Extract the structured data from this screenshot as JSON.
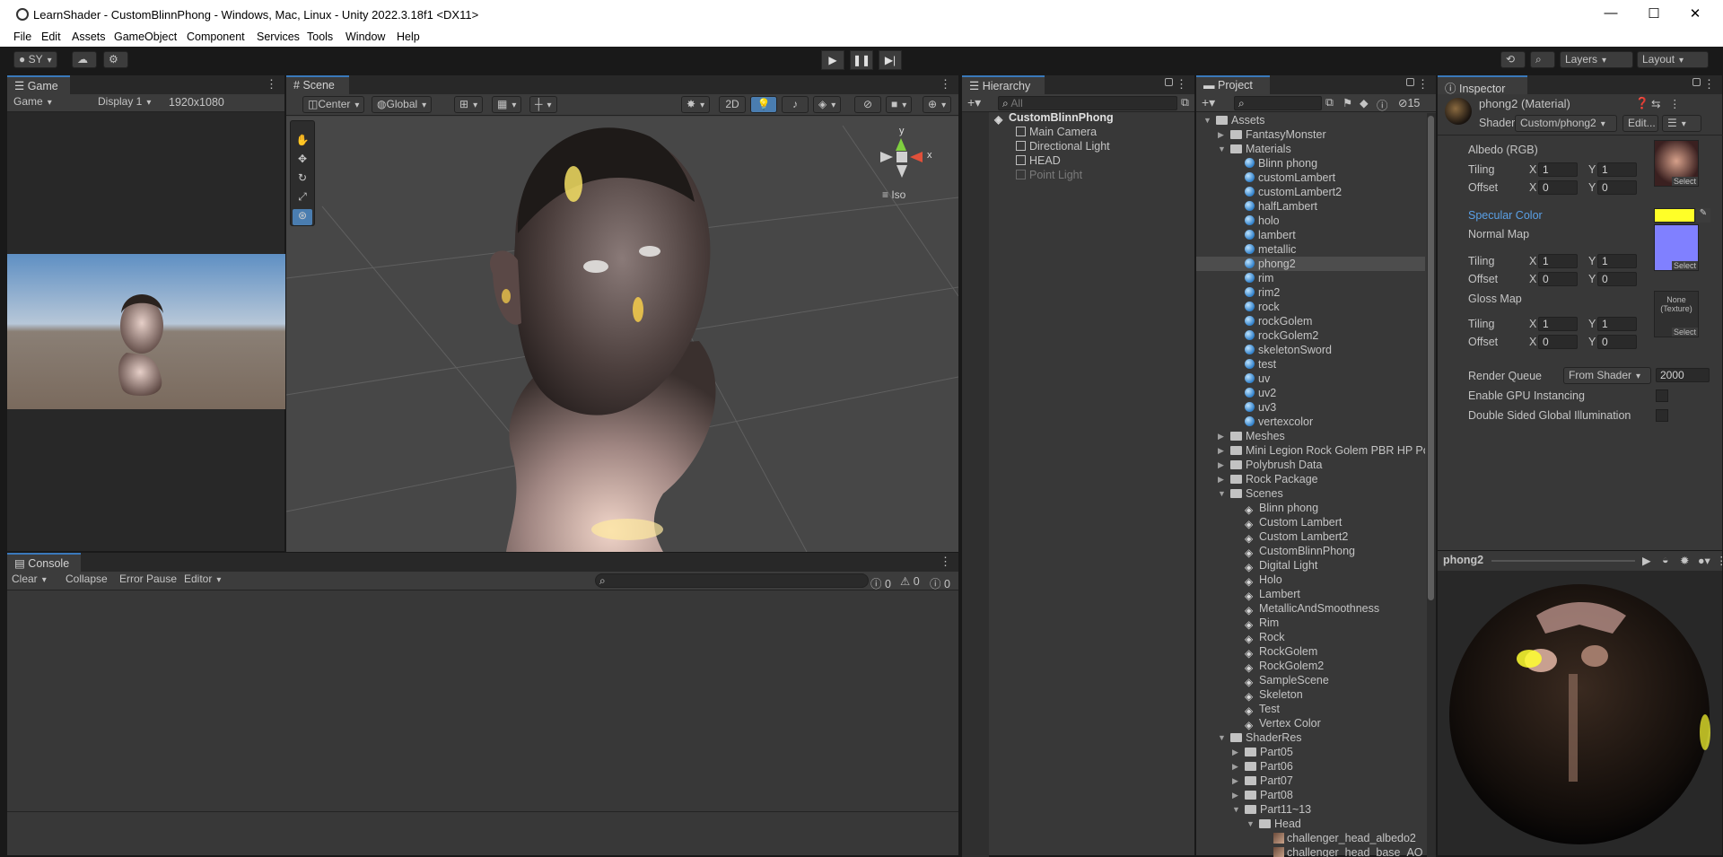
{
  "window": {
    "title": "LearnShader - CustomBlinnPhong - Windows, Mac, Linux - Unity 2022.3.18f1 <DX11>",
    "minimize": "—",
    "maximize": "☐",
    "close": "✕"
  },
  "menu": [
    "File",
    "Edit",
    "Assets",
    "GameObject",
    "Component",
    "Services",
    "Tools",
    "Window",
    "Help"
  ],
  "toolbar": {
    "account": "SY",
    "layers": "Layers",
    "layout": "Layout"
  },
  "game": {
    "tab": "Game",
    "mode": "Game",
    "display": "Display 1",
    "resolution": "1920x1080"
  },
  "scene": {
    "tab": "Scene",
    "pivot": "Center",
    "space": "Global",
    "mode2d": "2D",
    "projection": "Iso",
    "gizmo_y": "y",
    "gizmo_x": "x"
  },
  "hierarchy": {
    "tab": "Hierarchy",
    "search_placeholder": "All",
    "root": "CustomBlinnPhong",
    "items": [
      {
        "label": "Main Camera",
        "active": true
      },
      {
        "label": "Directional Light",
        "active": true
      },
      {
        "label": "HEAD",
        "active": true
      },
      {
        "label": "Point Light",
        "active": false
      }
    ]
  },
  "project": {
    "tab": "Project",
    "hidden_count": "15",
    "tree": [
      {
        "label": "Assets",
        "type": "folder",
        "depth": 0,
        "open": true
      },
      {
        "label": "FantasyMonster",
        "type": "folder",
        "depth": 1,
        "open": false
      },
      {
        "label": "Materials",
        "type": "folder",
        "depth": 1,
        "open": true
      },
      {
        "label": "Blinn phong",
        "type": "mat",
        "depth": 2
      },
      {
        "label": "customLambert",
        "type": "mat",
        "depth": 2
      },
      {
        "label": "customLambert2",
        "type": "mat",
        "depth": 2
      },
      {
        "label": "halfLambert",
        "type": "mat",
        "depth": 2
      },
      {
        "label": "holo",
        "type": "mat",
        "depth": 2
      },
      {
        "label": "lambert",
        "type": "mat",
        "depth": 2
      },
      {
        "label": "metallic",
        "type": "mat",
        "depth": 2
      },
      {
        "label": "phong2",
        "type": "mat",
        "depth": 2,
        "selected": true
      },
      {
        "label": "rim",
        "type": "mat",
        "depth": 2
      },
      {
        "label": "rim2",
        "type": "mat",
        "depth": 2
      },
      {
        "label": "rock",
        "type": "mat",
        "depth": 2
      },
      {
        "label": "rockGolem",
        "type": "mat",
        "depth": 2
      },
      {
        "label": "rockGolem2",
        "type": "mat",
        "depth": 2
      },
      {
        "label": "skeletonSword",
        "type": "mat",
        "depth": 2
      },
      {
        "label": "test",
        "type": "mat",
        "depth": 2
      },
      {
        "label": "uv",
        "type": "mat",
        "depth": 2
      },
      {
        "label": "uv2",
        "type": "mat",
        "depth": 2
      },
      {
        "label": "uv3",
        "type": "mat",
        "depth": 2
      },
      {
        "label": "vertexcolor",
        "type": "mat",
        "depth": 2
      },
      {
        "label": "Meshes",
        "type": "folder",
        "depth": 1,
        "open": false
      },
      {
        "label": "Mini Legion Rock Golem PBR HP Poly",
        "type": "folder",
        "depth": 1,
        "open": false
      },
      {
        "label": "Polybrush Data",
        "type": "folder",
        "depth": 1,
        "open": false
      },
      {
        "label": "Rock Package",
        "type": "folder",
        "depth": 1,
        "open": false
      },
      {
        "label": "Scenes",
        "type": "folder",
        "depth": 1,
        "open": true
      },
      {
        "label": "Blinn phong",
        "type": "scene",
        "depth": 2
      },
      {
        "label": "Custom Lambert",
        "type": "scene",
        "depth": 2
      },
      {
        "label": "Custom Lambert2",
        "type": "scene",
        "depth": 2
      },
      {
        "label": "CustomBlinnPhong",
        "type": "scene",
        "depth": 2
      },
      {
        "label": "Digital Light",
        "type": "scene",
        "depth": 2
      },
      {
        "label": "Holo",
        "type": "scene",
        "depth": 2
      },
      {
        "label": "Lambert",
        "type": "scene",
        "depth": 2
      },
      {
        "label": "MetallicAndSmoothness",
        "type": "scene",
        "depth": 2
      },
      {
        "label": "Rim",
        "type": "scene",
        "depth": 2
      },
      {
        "label": "Rock",
        "type": "scene",
        "depth": 2
      },
      {
        "label": "RockGolem",
        "type": "scene",
        "depth": 2
      },
      {
        "label": "RockGolem2",
        "type": "scene",
        "depth": 2
      },
      {
        "label": "SampleScene",
        "type": "scene",
        "depth": 2
      },
      {
        "label": "Skeleton",
        "type": "scene",
        "depth": 2
      },
      {
        "label": "Test",
        "type": "scene",
        "depth": 2
      },
      {
        "label": "Vertex Color",
        "type": "scene",
        "depth": 2
      },
      {
        "label": "ShaderRes",
        "type": "folder",
        "depth": 1,
        "open": true
      },
      {
        "label": "Part05",
        "type": "folder",
        "depth": 2,
        "open": false
      },
      {
        "label": "Part06",
        "type": "folder",
        "depth": 2,
        "open": false
      },
      {
        "label": "Part07",
        "type": "folder",
        "depth": 2,
        "open": false
      },
      {
        "label": "Part08",
        "type": "folder",
        "depth": 2,
        "open": false
      },
      {
        "label": "Part11~13",
        "type": "folder",
        "depth": 2,
        "open": true
      },
      {
        "label": "Head",
        "type": "folder",
        "depth": 3,
        "open": true
      },
      {
        "label": "challenger_head_albedo2",
        "type": "tex",
        "depth": 4
      },
      {
        "label": "challenger_head_base_AO",
        "type": "tex",
        "depth": 4
      }
    ]
  },
  "console": {
    "tab": "Console",
    "clear": "Clear",
    "collapse": "Collapse",
    "error_pause": "Error Pause",
    "editor": "Editor",
    "log_count": "0",
    "warn_count": "0",
    "err_count": "0"
  },
  "inspector": {
    "tab": "Inspector",
    "material_name": "phong2 (Material)",
    "shader_label": "Shader",
    "shader_value": "Custom/phong2",
    "edit_button": "Edit...",
    "albedo_label": "Albedo (RGB)",
    "tiling": "Tiling",
    "offset": "Offset",
    "x": "X",
    "y": "Y",
    "albedo_tiling": [
      "1",
      "1"
    ],
    "albedo_offset": [
      "0",
      "0"
    ],
    "select": "Select",
    "specular_label": "Specular Color",
    "specular_color": "#ffff28",
    "normal_label": "Normal Map",
    "normal_tiling": [
      "1",
      "1"
    ],
    "normal_offset": [
      "0",
      "0"
    ],
    "gloss_label": "Gloss Map",
    "gloss_none": "None (Texture)",
    "gloss_tiling": [
      "1",
      "1"
    ],
    "gloss_offset": [
      "0",
      "0"
    ],
    "render_queue_label": "Render Queue",
    "render_queue_mode": "From Shader",
    "render_queue_value": "2000",
    "gpu_instancing_label": "Enable GPU Instancing",
    "double_sided_gi_label": "Double Sided Global Illumination",
    "preview_name": "phong2"
  },
  "colors": {
    "accent": "#3a79bb",
    "selection": "#2c5d87",
    "specular": "#ffff28",
    "normal_map": "#8080ff"
  }
}
